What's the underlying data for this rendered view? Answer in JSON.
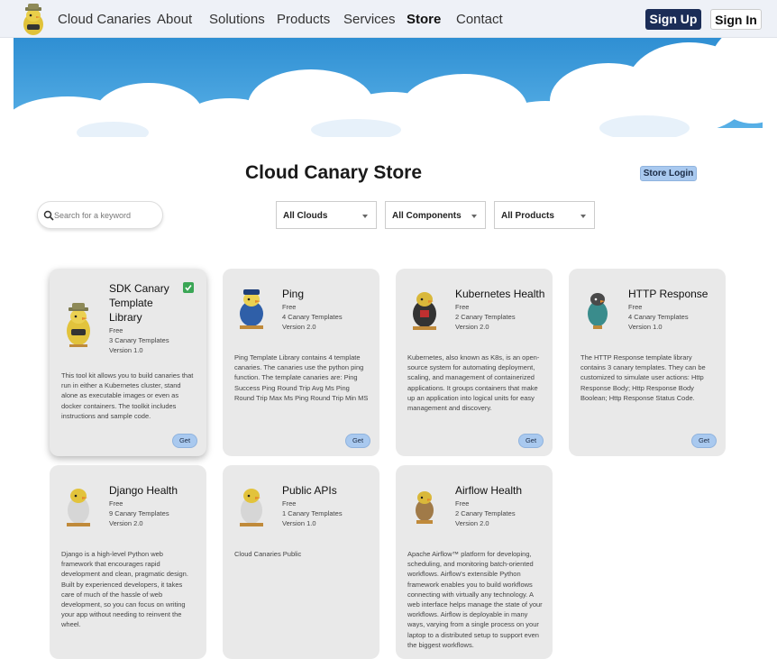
{
  "nav": {
    "brand": "Cloud Canaries",
    "links": [
      "About",
      "Solutions",
      "Products",
      "Services",
      "Store",
      "Contact"
    ],
    "signup": "Sign Up",
    "signin": "Sign In"
  },
  "store": {
    "title": "Cloud Canary Store",
    "login": "Store Login"
  },
  "search": {
    "placeholder": "Search for a keyword"
  },
  "filters": [
    "All Clouds",
    "All Components",
    "All Products"
  ],
  "cards": [
    {
      "title": "SDK Canary Template Library",
      "title_lines": [
        "SDK Canary",
        "Template",
        "Library"
      ],
      "price": "Free",
      "templates": "3 Canary Templates",
      "version": "Version 1.0",
      "desc": "This tool kit allows you to build canaries that run in either a Kubernetes cluster, stand alone as executable images or even as docker containers. The toolkit includes instructions and sample code.",
      "get": "Get"
    },
    {
      "title": "Ping",
      "price": "Free",
      "templates": "4 Canary Templates",
      "version": "Version 2.0",
      "desc": "Ping Template Library contains 4 template canaries. The canaries use the python ping function. The template canaries are: Ping Success Ping Round Trip Avg Ms Ping Round Trip Max Ms Ping Round Trip Min MS",
      "get": "Get"
    },
    {
      "title": "Kubernetes Health",
      "price": "Free",
      "templates": "2 Canary Templates",
      "version": "Version 2.0",
      "desc": "Kubernetes, also known as K8s, is an open-source system for automating deployment, scaling, and management of containerized applications. It groups containers that make up an application into logical units for easy management and discovery.",
      "get": "Get"
    },
    {
      "title": "HTTP Response",
      "price": "Free",
      "templates": "4 Canary Templates",
      "version": "Version 1.0",
      "desc": "The HTTP Response template library contains 3 canary templates. They can be customized to simulate user actions: Http Response Body; Http Response Body Boolean; Http Response Status Code.",
      "get": "Get"
    },
    {
      "title": "Django Health",
      "price": "Free",
      "templates": "9 Canary Templates",
      "version": "Version 2.0",
      "desc": "Django is a high-level Python web framework that encourages rapid development and clean, pragmatic design. Built by experienced developers, it takes care of much of the hassle of web development, so you can focus on writing your app without needing to reinvent the wheel."
    },
    {
      "title": "Public APIs",
      "price": "Free",
      "templates": "1 Canary Templates",
      "version": "Version 1.0",
      "desc": "Cloud Canaries Public"
    },
    {
      "title": "Airflow Health",
      "price": "Free",
      "templates": "2 Canary Templates",
      "version": "Version 2.0",
      "desc": "Apache Airflow™ platform for developing, scheduling, and monitoring batch-oriented workflows. Airflow's extensible Python framework enables you to build workflows connecting with virtually any technology. A web interface helps manage the state of your workflows. Airflow is deployable in many ways, varying from a single process on your laptop to a distributed setup to support even the biggest workflows."
    }
  ],
  "colors": {
    "nav_bg": "#eef1f7",
    "primary_dark": "#1b2d57",
    "accent_button": "#a9c9ef",
    "card_bg": "#e9e9e9",
    "sky": "#3d9ad6",
    "check": "#3aa655"
  }
}
